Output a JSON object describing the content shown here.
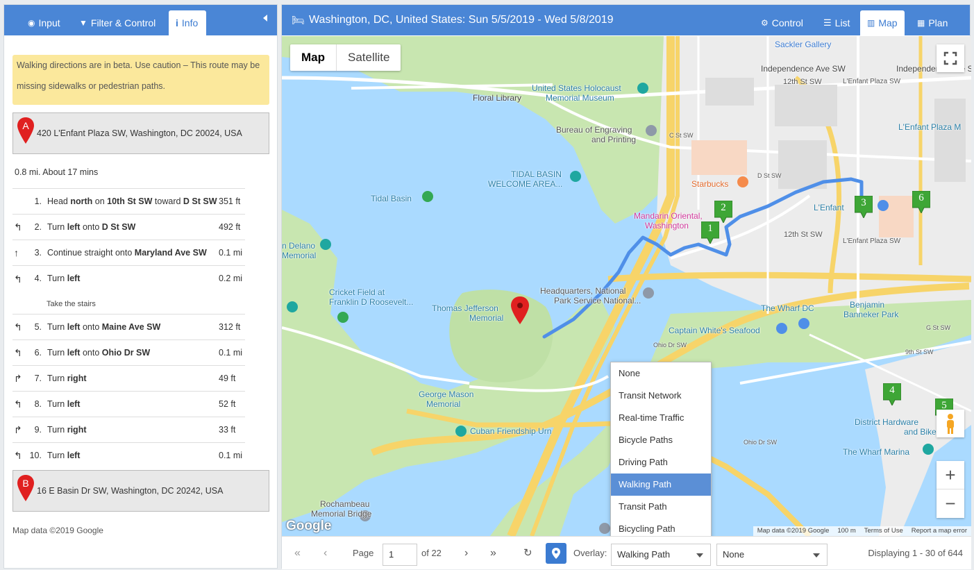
{
  "left": {
    "tabs": {
      "input": "Input",
      "filter": "Filter & Control",
      "info": "Info"
    },
    "beta_line1": "Walking directions are in beta. Use caution – This route may be",
    "beta_line2": "missing sidewalks or pedestrian paths.",
    "start": {
      "marker": "A",
      "address": "420 L'Enfant Plaza SW, Washington, DC 20024, USA"
    },
    "summary": "0.8 mi. About 17 mins",
    "steps": [
      {
        "num": "1.",
        "icon": "",
        "pre": "Head ",
        "b1": "north",
        "mid": " on ",
        "b2": "10th St SW",
        "mid2": " toward ",
        "b3": "D St SW",
        "dist": "351 ft"
      },
      {
        "num": "2.",
        "icon": "turn-left",
        "pre": "Turn ",
        "b1": "left",
        "mid": " onto ",
        "b2": "D St SW",
        "mid2": "",
        "b3": "",
        "dist": "492 ft"
      },
      {
        "num": "3.",
        "icon": "straight",
        "pre": "Continue straight onto ",
        "b1": "Maryland Ave SW",
        "mid": "",
        "b2": "",
        "mid2": "",
        "b3": "",
        "dist": "0.1 mi"
      },
      {
        "num": "4.",
        "icon": "turn-left",
        "pre": "Turn ",
        "b1": "left",
        "mid": "",
        "b2": "",
        "mid2": "",
        "b3": "",
        "dist": "0.2 mi",
        "note": "Take the stairs"
      },
      {
        "num": "5.",
        "icon": "turn-left",
        "pre": "Turn ",
        "b1": "left",
        "mid": " onto ",
        "b2": "Maine Ave SW",
        "mid2": "",
        "b3": "",
        "dist": "312 ft"
      },
      {
        "num": "6.",
        "icon": "turn-left",
        "pre": "Turn ",
        "b1": "left",
        "mid": " onto ",
        "b2": "Ohio Dr SW",
        "mid2": "",
        "b3": "",
        "dist": "0.1 mi"
      },
      {
        "num": "7.",
        "icon": "turn-right",
        "pre": "Turn ",
        "b1": "right",
        "mid": "",
        "b2": "",
        "mid2": "",
        "b3": "",
        "dist": "49 ft"
      },
      {
        "num": "8.",
        "icon": "turn-left",
        "pre": "Turn ",
        "b1": "left",
        "mid": "",
        "b2": "",
        "mid2": "",
        "b3": "",
        "dist": "52 ft"
      },
      {
        "num": "9.",
        "icon": "turn-right",
        "pre": "Turn ",
        "b1": "right",
        "mid": "",
        "b2": "",
        "mid2": "",
        "b3": "",
        "dist": "33 ft"
      },
      {
        "num": "10.",
        "icon": "turn-left",
        "pre": "Turn ",
        "b1": "left",
        "mid": "",
        "b2": "",
        "mid2": "",
        "b3": "",
        "dist": "0.1 mi"
      }
    ],
    "end": {
      "marker": "B",
      "address": "16 E Basin Dr SW, Washington, DC 20242, USA"
    },
    "credit": "Map data ©2019 Google"
  },
  "right": {
    "title": "Washington, DC, United States: Sun 5/5/2019 - Wed 5/8/2019",
    "tabs": {
      "control": "Control",
      "list": "List",
      "map": "Map",
      "plan": "Plan"
    },
    "map_type": {
      "map": "Map",
      "satellite": "Satellite"
    },
    "labels": [
      "Sackler Gallery",
      "Independence Ave SW",
      "Independence Ave SW",
      "United States Holocaust",
      "Memorial Museum",
      "Floral Library",
      "Bureau of Engraving",
      "and Printing",
      "TIDAL BASIN",
      "WELCOME AREA...",
      "Tidal Basin",
      "Starbucks",
      "Mandarin Oriental,",
      "Washington",
      "L'Enfant",
      "L'Enfant Plaza M",
      "Cricket Field at",
      "Franklin D Roosevelt...",
      "Thomas Jefferson",
      "Memorial",
      "Headquarters, National",
      "Park Service National...",
      "The Wharf DC",
      "Benjamin",
      "Banneker Park",
      "Captain White's Seafood",
      "George Mason",
      "Memorial",
      "Cuban Friendship Urn",
      "District Hardware",
      "and Bike",
      "The Wharf Marina",
      "Rochambeau",
      "Memorial Bridge",
      "D St SW",
      "C St SW",
      "12th St SW",
      "12th St SW",
      "L'Enfant Plaza SW",
      "L'Enfant Plaza SW",
      "G St SW",
      "9th St SW",
      "Ohio Dr SW",
      "Ohio Dr SW",
      "n Delano",
      "Memorial"
    ],
    "markers": [
      "1",
      "2",
      "3",
      "4",
      "5",
      "6"
    ],
    "overlay_options": [
      "None",
      "Transit Network",
      "Real-time Traffic",
      "Bicycle Paths",
      "Driving Path",
      "Walking Path",
      "Transit Path",
      "Bicycling Path"
    ],
    "overlay_selected": "Walking Path",
    "footer": {
      "mapdata": "Map data ©2019 Google",
      "scale": "100 m",
      "terms": "Terms of Use",
      "report": "Report a map error"
    },
    "google": "Google",
    "pager": {
      "page_label": "Page",
      "page_value": "1",
      "of": "of 22",
      "overlay_label": "Overlay:",
      "overlay_value": "Walking Path",
      "second_value": "None",
      "displaying": "Displaying 1 - 30 of 644"
    }
  },
  "colors": {
    "header": "#4a86d6",
    "route": "#4f8fe8",
    "marker_green": "#3ea636",
    "water": "#aadaff",
    "park": "#c8e6b0",
    "road": "#f7d469"
  }
}
